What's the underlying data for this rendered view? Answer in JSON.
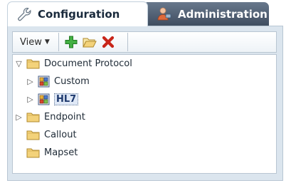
{
  "tabs": [
    {
      "label": "Configuration",
      "icon": "wrench-icon",
      "active": true
    },
    {
      "label": "Administration",
      "icon": "admin-user-icon",
      "active": false
    }
  ],
  "toolbar": {
    "view_label": "View",
    "buttons": [
      "add-icon",
      "open-folder-icon",
      "delete-icon"
    ]
  },
  "tree": {
    "nodes": [
      {
        "label": "Document Protocol",
        "state": "expanded",
        "level": 0,
        "icon": "folder-icon"
      },
      {
        "label": "Custom",
        "state": "collapsed",
        "level": 1,
        "icon": "package-icon"
      },
      {
        "label": "HL7",
        "state": "collapsed",
        "level": 1,
        "icon": "package-icon",
        "selected": true
      },
      {
        "label": "Endpoint",
        "state": "collapsed",
        "level": 0,
        "icon": "folder-icon"
      },
      {
        "label": "Callout",
        "state": "leaf",
        "level": 0,
        "icon": "folder-icon"
      },
      {
        "label": "Mapset",
        "state": "leaf",
        "level": 0,
        "icon": "folder-icon"
      }
    ]
  },
  "colors": {
    "panel_bg": "#dbe5ee",
    "inactive_tab": "#4d5b6e",
    "folder": "#f3d27a",
    "add": "#3aa63a",
    "delete": "#d12a1a"
  }
}
